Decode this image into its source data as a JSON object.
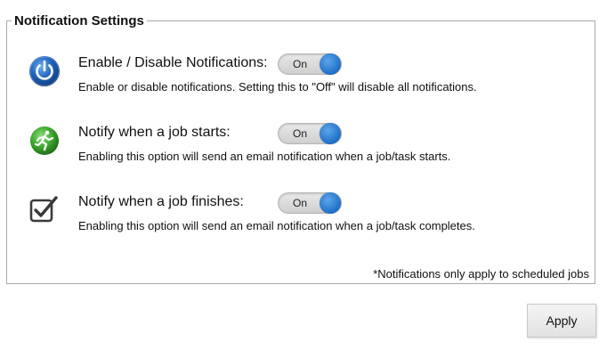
{
  "panel": {
    "title": "Notification Settings",
    "footnote": "*Notifications only apply to scheduled jobs"
  },
  "settings": [
    {
      "icon": "power-icon",
      "label": "Enable / Disable Notifications:",
      "description": "Enable or disable notifications. Setting this to \"Off\" will disable all notifications.",
      "toggle_label": "On"
    },
    {
      "icon": "running-man-icon",
      "label": "Notify when a job starts:",
      "description": "Enabling this option will send an email notification when a job/task starts.",
      "toggle_label": "On"
    },
    {
      "icon": "checkbox-check-icon",
      "label": "Notify when a job finishes:",
      "description": "Enabling this option will send an email notification when a job/task completes.",
      "toggle_label": "On"
    }
  ],
  "actions": {
    "apply_label": "Apply"
  },
  "colors": {
    "toggle_knob": "#1f6fc7",
    "power_icon": "#1d5fb8",
    "running_icon": "#3aa52d",
    "border": "#a9a9a9"
  }
}
